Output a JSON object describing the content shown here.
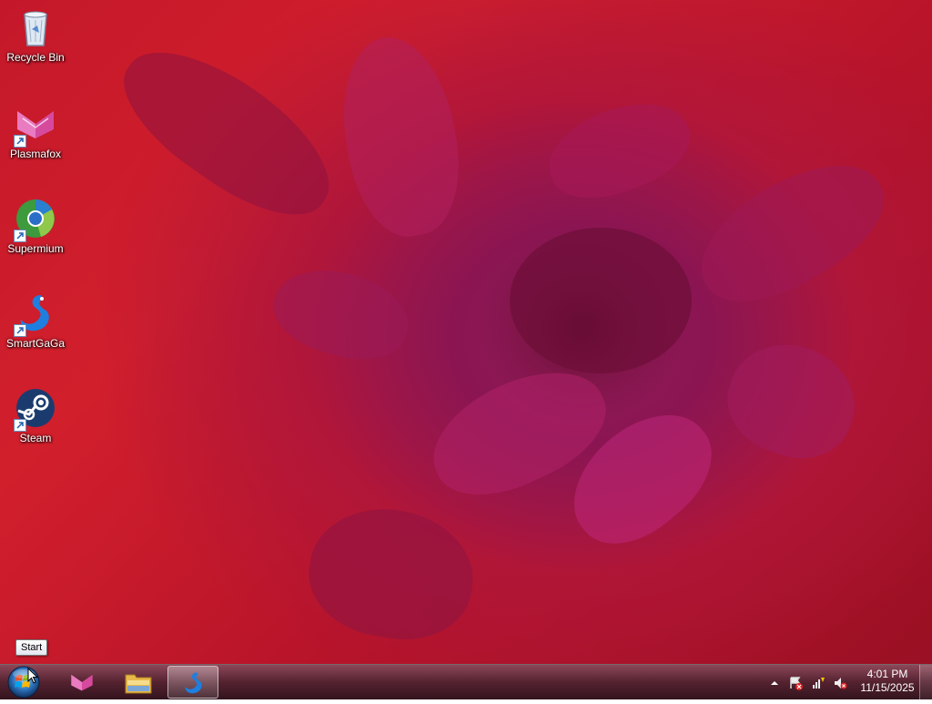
{
  "desktop": {
    "icons": [
      {
        "label": "Recycle Bin",
        "icon": "recycle-bin-icon"
      },
      {
        "label": "Plasmafox",
        "icon": "plasmafox-icon"
      },
      {
        "label": "Supermium",
        "icon": "supermium-icon"
      },
      {
        "label": "SmartGaGa",
        "icon": "smartgaga-icon"
      },
      {
        "label": "Steam",
        "icon": "steam-icon"
      }
    ]
  },
  "start_tooltip": "Start",
  "taskbar": {
    "pinned": [
      {
        "icon": "plasmafox-icon",
        "active": false
      },
      {
        "icon": "file-explorer-icon",
        "active": false
      },
      {
        "icon": "smartgaga-icon",
        "active": true
      }
    ],
    "tray_icons": [
      "show-hidden-icons-arrow",
      "action-center-icon",
      "network-icon",
      "volume-muted-icon"
    ],
    "clock": {
      "time": "4:01 PM",
      "date": "11/15/2025"
    }
  },
  "colors": {
    "wallpaper_red": "#c4182a",
    "flower_magenta": "#9c1f62",
    "taskbar": "#4a0f1e"
  }
}
